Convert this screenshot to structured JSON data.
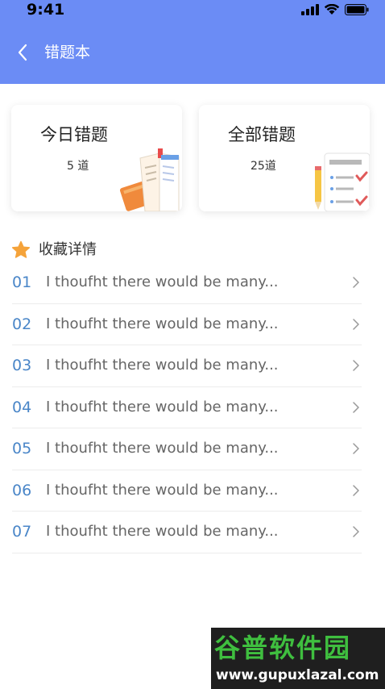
{
  "status_bar": {
    "time": "9:41"
  },
  "nav": {
    "title": "错题本"
  },
  "cards": [
    {
      "title": "今日错题",
      "count": "5 道"
    },
    {
      "title": "全部错题",
      "count": "25道"
    }
  ],
  "section": {
    "title": "收藏详情"
  },
  "list": [
    {
      "num": "01",
      "text": "I thoufht there would be many..."
    },
    {
      "num": "02",
      "text": "I thoufht there would be many..."
    },
    {
      "num": "03",
      "text": "I thoufht there would be many..."
    },
    {
      "num": "04",
      "text": "I thoufht there would be many..."
    },
    {
      "num": "05",
      "text": "I thoufht there would be many..."
    },
    {
      "num": "06",
      "text": "I thoufht there would be many..."
    },
    {
      "num": "07",
      "text": "I thoufht there would be many..."
    }
  ],
  "watermark": {
    "brand": "谷普软件园",
    "url": "www.gupuxlazal.com"
  },
  "colors": {
    "header": "#6b8cf5",
    "number": "#4a86c8",
    "star": "#f5a33a"
  }
}
